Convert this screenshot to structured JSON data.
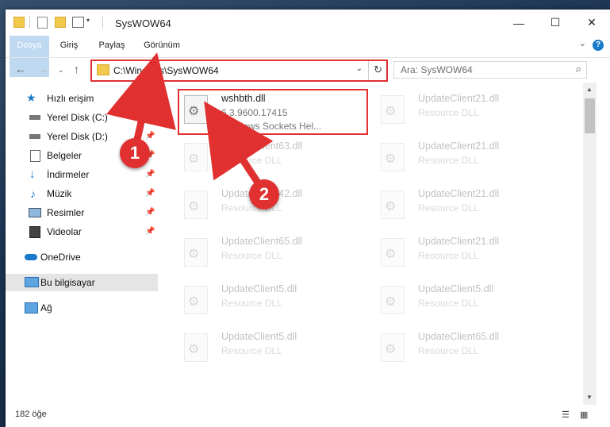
{
  "window": {
    "title": "SysWOW64",
    "minimize": "—",
    "maximize": "☐",
    "close": "✕"
  },
  "ribbon": {
    "tabs": [
      "Dosya",
      "Giriş",
      "Paylaş",
      "Görünüm"
    ],
    "expand": "⌄",
    "help": "?"
  },
  "address_bar": {
    "path": "C:\\Windows\\SysWOW64",
    "dropdown": "⌄",
    "refresh": "↻"
  },
  "nav_buttons": {
    "back": "←",
    "forward": "→",
    "recent": "⌄",
    "up": "↑"
  },
  "search": {
    "placeholder": "Ara: SysWOW64",
    "icon": "⌕"
  },
  "nav_pane": [
    {
      "label": "Hızlı erişim",
      "icon": "star-icon",
      "pinned": false
    },
    {
      "label": "Yerel Disk (C:)",
      "icon": "drive-icon",
      "pinned": true
    },
    {
      "label": "Yerel Disk (D:)",
      "icon": "drive-icon",
      "pinned": true
    },
    {
      "label": "Belgeler",
      "icon": "documents-icon",
      "pinned": true
    },
    {
      "label": "İndirmeler",
      "icon": "download-icon",
      "pinned": true
    },
    {
      "label": "Müzik",
      "icon": "music-icon",
      "pinned": true
    },
    {
      "label": "Resimler",
      "icon": "pictures-icon",
      "pinned": true
    },
    {
      "label": "Videolar",
      "icon": "videos-icon",
      "pinned": true
    },
    {
      "label": "OneDrive",
      "icon": "cloud-icon",
      "pinned": false
    },
    {
      "label": "Bu bilgisayar",
      "icon": "computer-icon",
      "pinned": false,
      "selected": true
    },
    {
      "label": "Ağ",
      "icon": "network-icon",
      "pinned": false
    }
  ],
  "files": [
    {
      "name": "wshbth.dll",
      "line2": "6.3.9600.17415",
      "line3": "Windows Sockets Hel..."
    },
    {
      "name": "UpdateClient21.dll",
      "line2": "Resource DLL",
      "line3": ""
    },
    {
      "name": "UpdateClient63.dll",
      "line2": "Resource DLL",
      "line3": ""
    },
    {
      "name": "UpdateClient21.dll",
      "line2": "Resource DLL",
      "line3": ""
    },
    {
      "name": "UpdateClient42.dll",
      "line2": "Resource DLL",
      "line3": ""
    },
    {
      "name": "UpdateClient21.dll",
      "line2": "Resource DLL",
      "line3": ""
    },
    {
      "name": "UpdateClient65.dll",
      "line2": "Resource DLL",
      "line3": ""
    },
    {
      "name": "UpdateClient21.dll",
      "line2": "Resource DLL",
      "line3": ""
    },
    {
      "name": "UpdateClient5.dll",
      "line2": "Resource DLL",
      "line3": ""
    },
    {
      "name": "UpdateClient5.dll",
      "line2": "Resource DLL",
      "line3": ""
    },
    {
      "name": "UpdateClient5.dll",
      "line2": "Resource DLL",
      "line3": ""
    },
    {
      "name": "UpdateClient65.dll",
      "line2": "Resource DLL",
      "line3": ""
    }
  ],
  "status": {
    "item_count": "182 öğe"
  },
  "annotations": {
    "step1": "1",
    "step2": "2"
  },
  "colors": {
    "accent": "#1979ca",
    "highlight": "#e03030",
    "folder": "#f2c94c"
  }
}
